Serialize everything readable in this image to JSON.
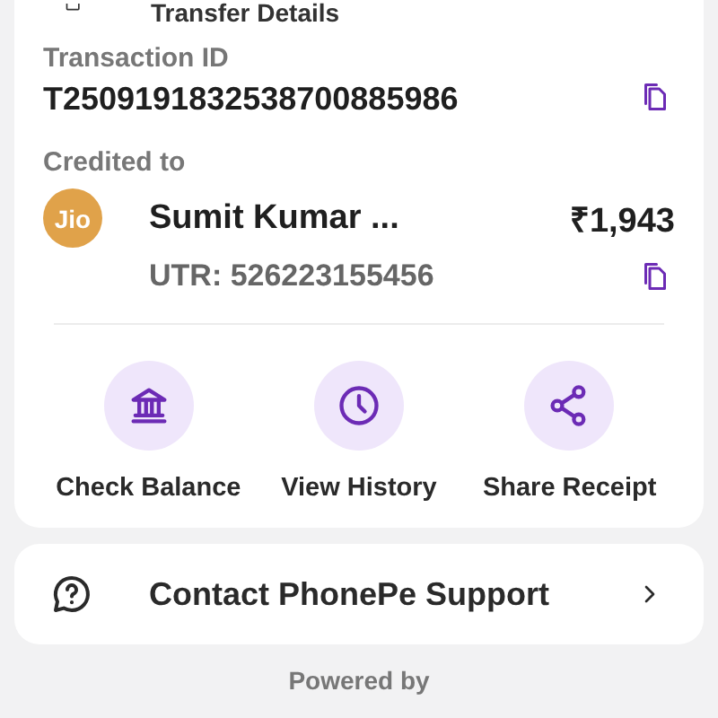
{
  "section": {
    "title": "Transfer Details"
  },
  "transaction": {
    "label": "Transaction ID",
    "value": "T2509191832538700885986"
  },
  "credited": {
    "label": "Credited to",
    "logo_text": "Jio",
    "name": "Sumit Kumar ...",
    "amount": "₹1,943",
    "utr": "UTR: 526223155456"
  },
  "actions": [
    {
      "kind": "bank",
      "label": "Check Balance"
    },
    {
      "kind": "history",
      "label": "View History"
    },
    {
      "kind": "share",
      "label": "Share Receipt"
    }
  ],
  "support": {
    "label": "Contact PhonePe Support"
  },
  "footer": {
    "text": "Powered by"
  }
}
